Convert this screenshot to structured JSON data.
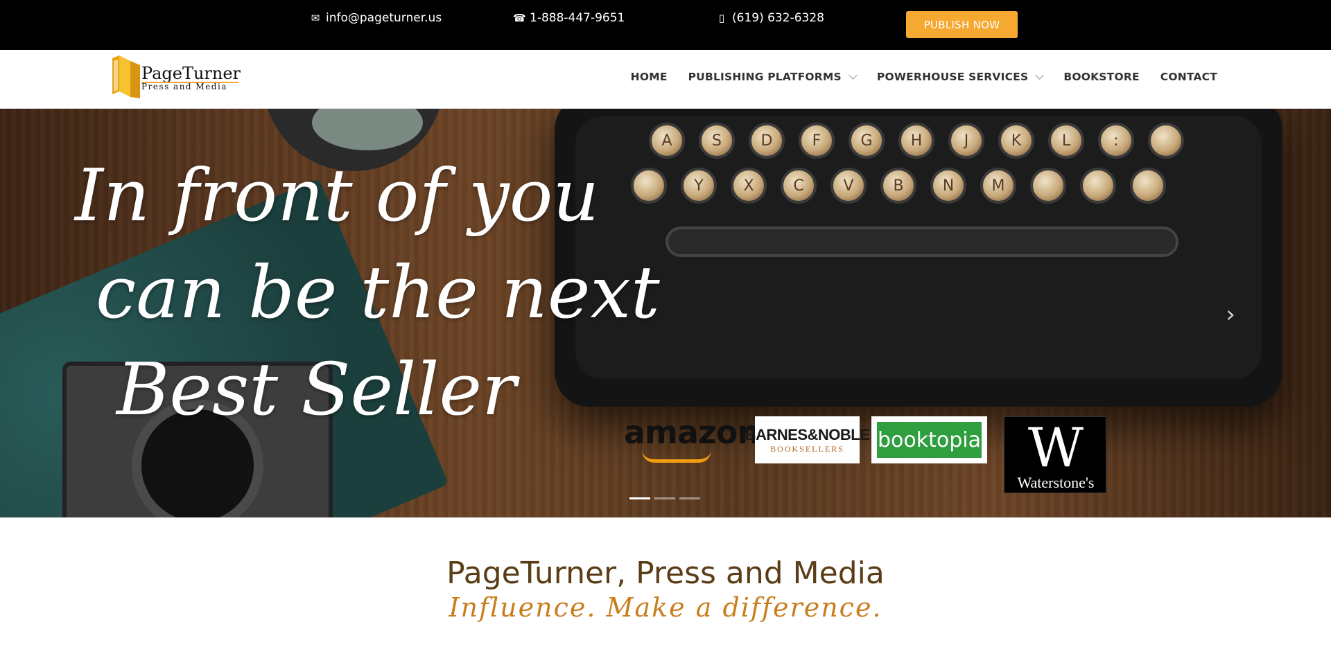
{
  "topbar": {
    "email": "info@pageturner.us",
    "phone_tollfree": "1-888-447-9651",
    "phone_local": "(619) 632-6328",
    "publish_label": "PUBLISH NOW",
    "icons": {
      "email": "envelope-icon",
      "phone": "phone-icon",
      "mobile": "mobile-phone-icon"
    },
    "accent_color": "#f6a930"
  },
  "logo": {
    "name": "PageTurner",
    "subtitle": "Press and Media"
  },
  "nav": {
    "items": [
      {
        "label": "HOME",
        "has_dropdown": false
      },
      {
        "label": "PUBLISHING PLATFORMS",
        "has_dropdown": true
      },
      {
        "label": "POWERHOUSE SERVICES",
        "has_dropdown": true
      },
      {
        "label": "BOOKSTORE",
        "has_dropdown": false
      },
      {
        "label": "CONTACT",
        "has_dropdown": false
      }
    ]
  },
  "hero": {
    "line1": "In front of you",
    "line2": "can be the next",
    "line3": "Best Seller",
    "next_icon": "chevron-right-icon",
    "keys_row1": [
      "A",
      "S",
      "D",
      "F",
      "G",
      "H",
      "J",
      "K",
      "L",
      ":",
      ""
    ],
    "keys_row2": [
      "",
      "Y",
      "X",
      "C",
      "V",
      "B",
      "N",
      "M",
      "",
      "",
      ""
    ],
    "partners": {
      "amazon": "amazon",
      "bn_title": "BARNES&NOBLE",
      "bn_sub": "BOOKSELLERS",
      "booktopia": "booktopia",
      "waterstones_mark": "W",
      "waterstones_name": "Waterstone's"
    },
    "slides_total": 3,
    "active_slide": 1
  },
  "intro": {
    "title": "PageTurner, Press and Media",
    "tagline": "Influence. Make a difference.",
    "title_color": "#5a3d16",
    "tagline_color": "#c97e1e"
  }
}
